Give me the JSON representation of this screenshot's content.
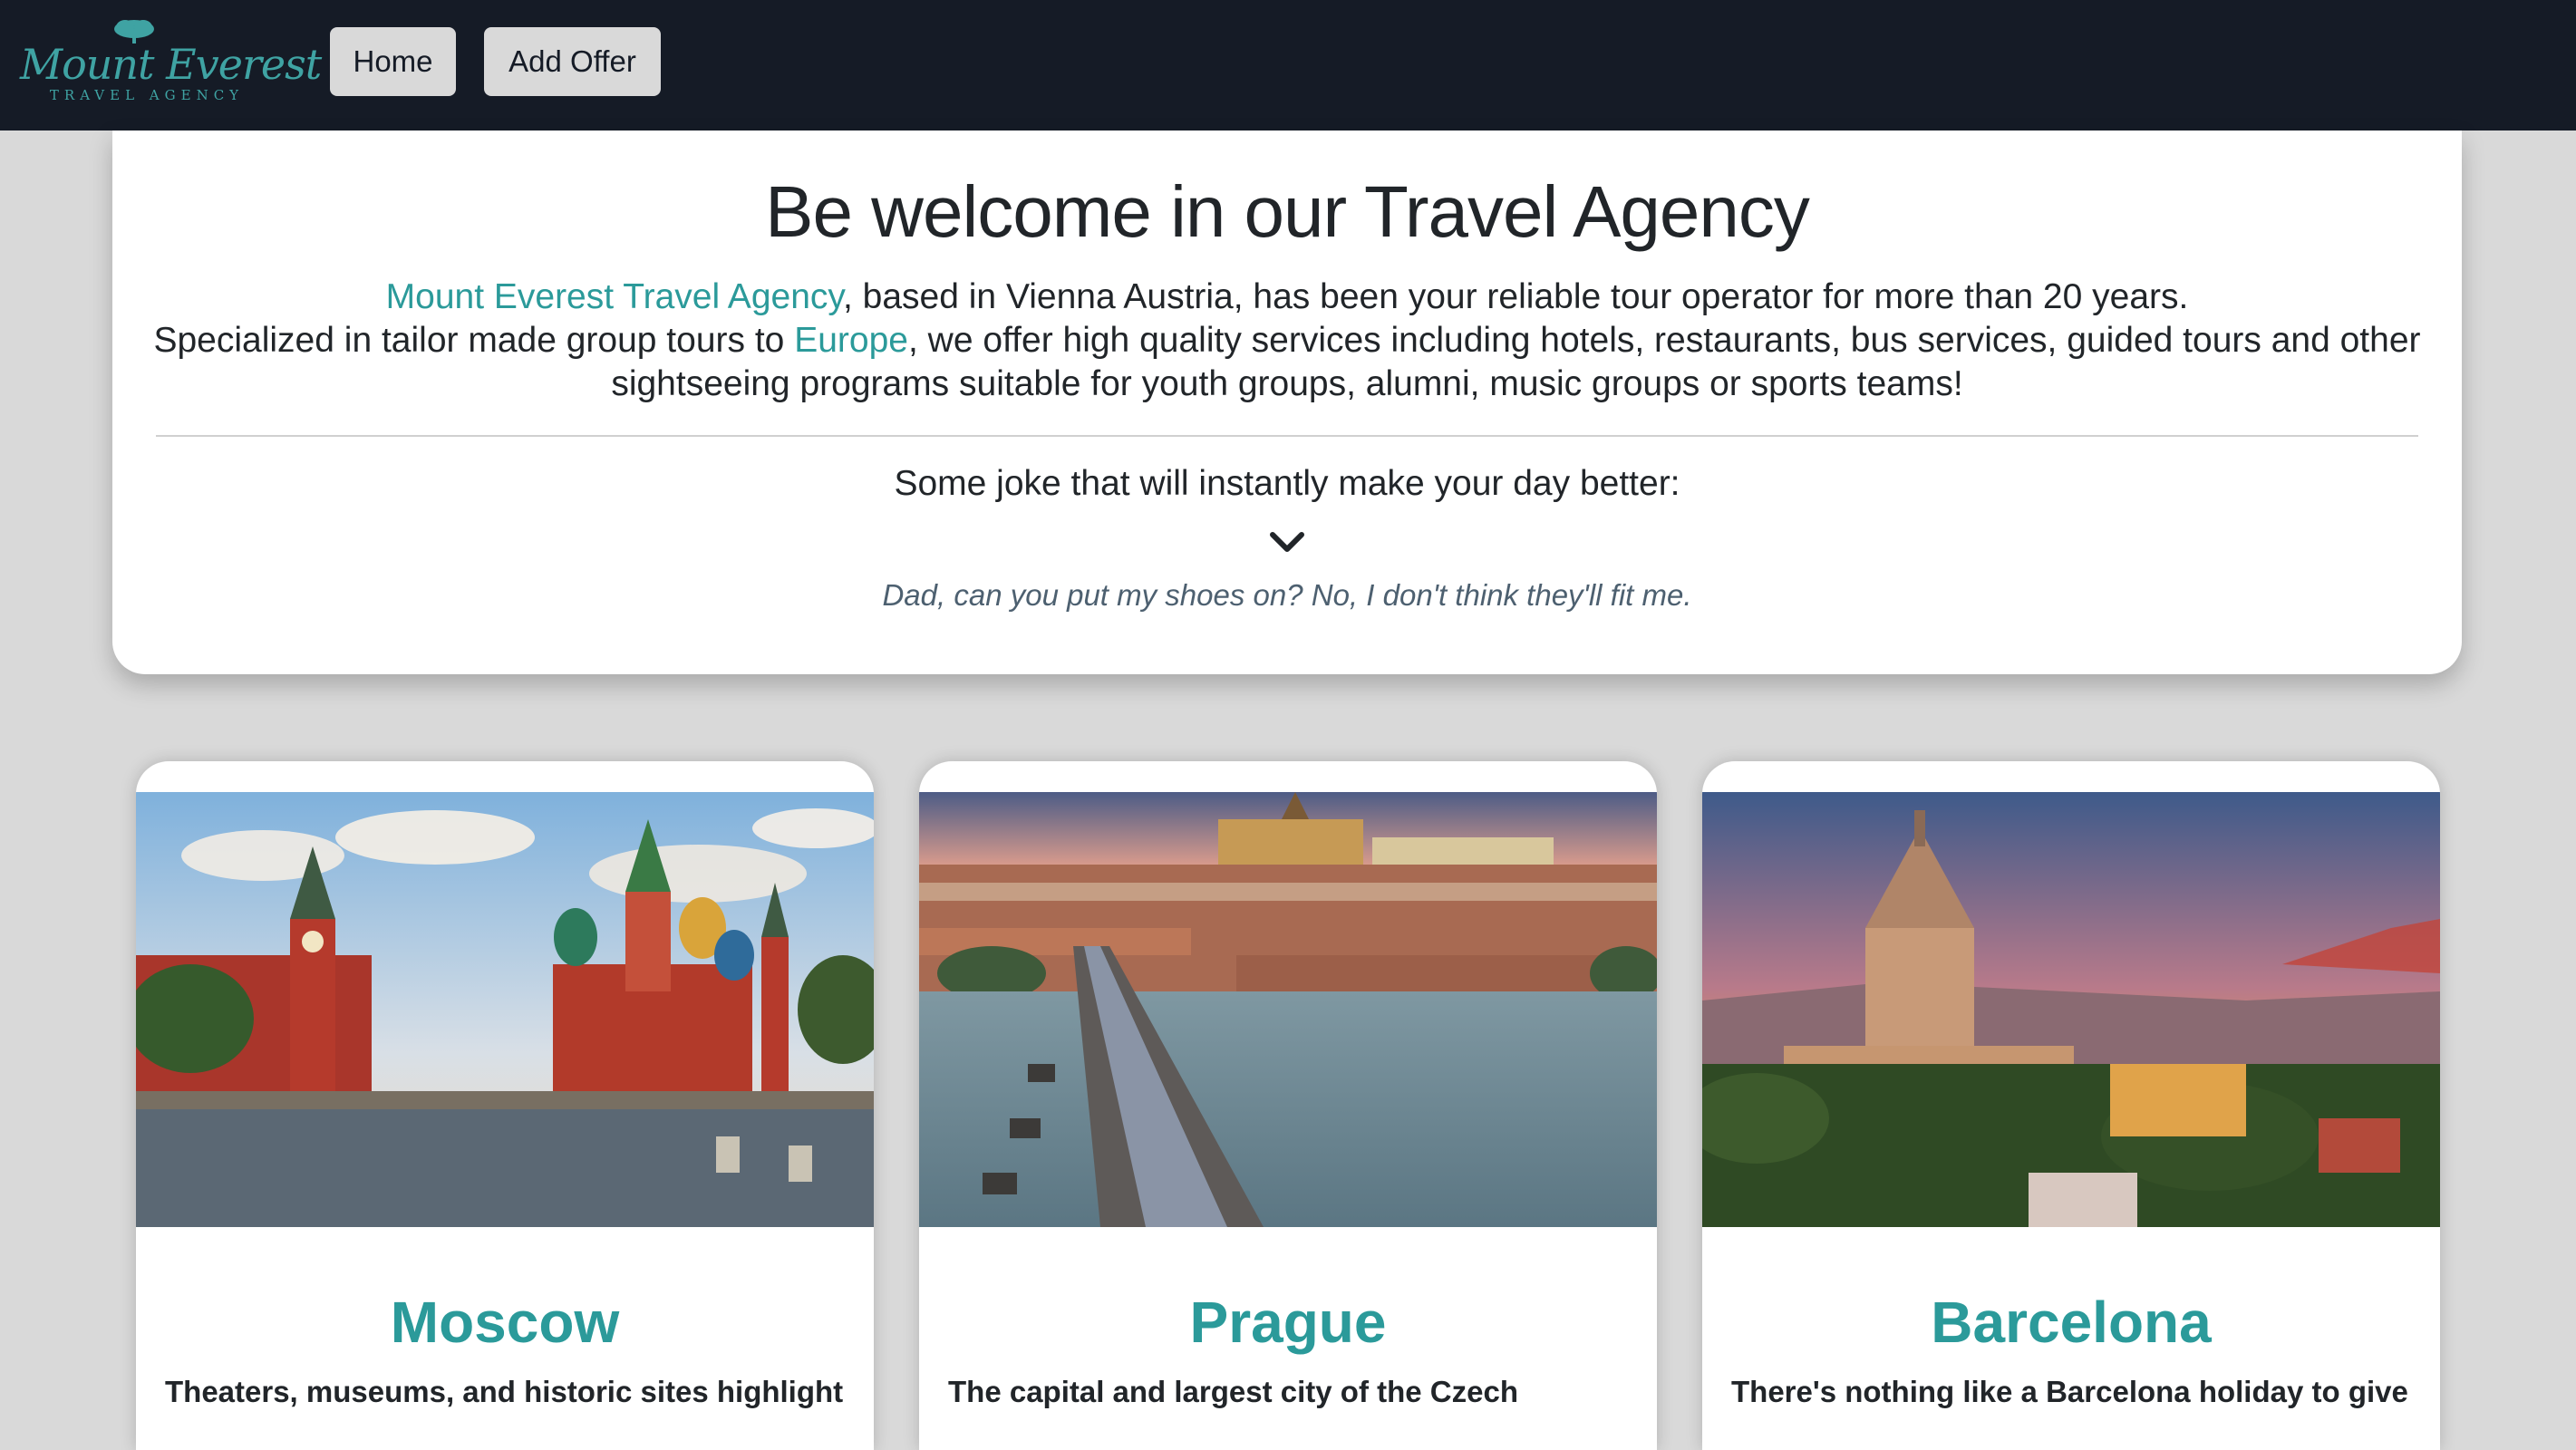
{
  "navbar": {
    "logo": {
      "name": "Mount Everest",
      "subtitle": "TRAVEL AGENCY",
      "icon": "tree-icon"
    },
    "links": {
      "home": "Home",
      "add_offer": "Add Offer"
    },
    "background_color": "#151b26",
    "button_color": "#d9d9d9"
  },
  "welcome": {
    "title": "Be welcome in our Travel Agency",
    "intro": {
      "agency_link": "Mount Everest Travel Agency",
      "line1_rest": ", based in Vienna Austria, has been your reliable tour operator for more than 20 years.",
      "line2_start": "Specialized in tailor made group tours to ",
      "europe_link": "Europe",
      "line2_rest": ", we offer high quality services including hotels, restaurants, bus services, guided tours and other sightseeing programs suitable for youth groups, alumni, music groups or sports teams!"
    },
    "joke": {
      "title": "Some joke that will instantly make your day better:",
      "icon": "chevron-down-icon",
      "text": "Dad, can you put my shoes on? No, I don't think they'll fit me."
    }
  },
  "offers": [
    {
      "city": "Moscow",
      "description": "Theaters, museums, and historic sites highlight",
      "image": "moscow-photo"
    },
    {
      "city": "Prague",
      "description": "The capital and largest city of the Czech",
      "image": "prague-photo"
    },
    {
      "city": "Barcelona",
      "description": "There's nothing like a Barcelona holiday to give",
      "image": "barcelona-photo"
    }
  ],
  "colors": {
    "accent": "#2b9a9a",
    "page_background": "#d9d9d9",
    "card_background": "#ffffff",
    "joke_text": "#4d6070"
  }
}
